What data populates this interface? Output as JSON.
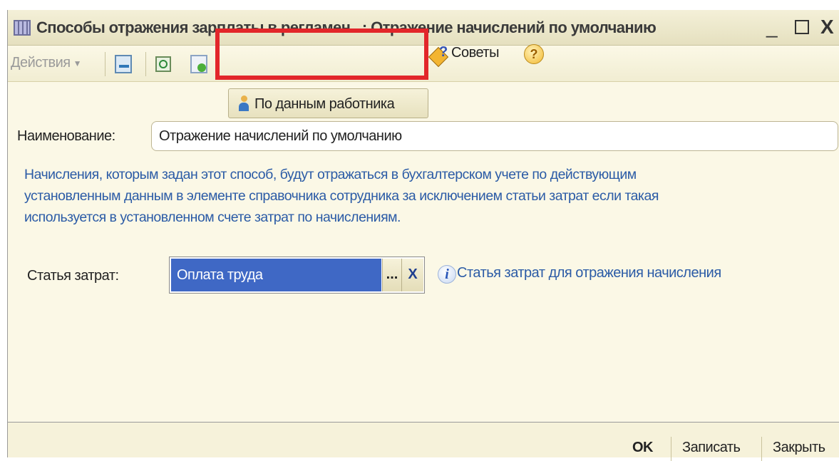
{
  "window": {
    "title": "Способы отражения зарплаты в регламен...: Отражение начислений по умолчанию",
    "minimize": "_",
    "close": "X"
  },
  "toolbar": {
    "actions_label": "Действия",
    "employee_button_label": "По данным работника",
    "tips_label": "Советы",
    "help_label": "?"
  },
  "form": {
    "name_label": "Наименование:",
    "name_value": "Отражение начислений по умолчанию",
    "info_lines": [
      "Начисления, которым задан этот способ, будут отражаться в бухгалтерском учете по действующим",
      "установленным данным в элементе справочника сотрудника за исключением статьи затрат если такая",
      "используется в установленном счете затрат по начислениям."
    ],
    "cost_label": "Статья затрат:",
    "cost_value": "Оплата труда",
    "cost_select": "...",
    "cost_clear": "X",
    "cost_hint": "Статья затрат для отражения начисления"
  },
  "buttons": {
    "ok": "OK",
    "save": "Записать",
    "close": "Закрыть"
  },
  "colors": {
    "highlight": "#e2262a",
    "selection": "#3f68c5",
    "info_text": "#2b5ba6",
    "window_bg": "#fbf8e6"
  }
}
